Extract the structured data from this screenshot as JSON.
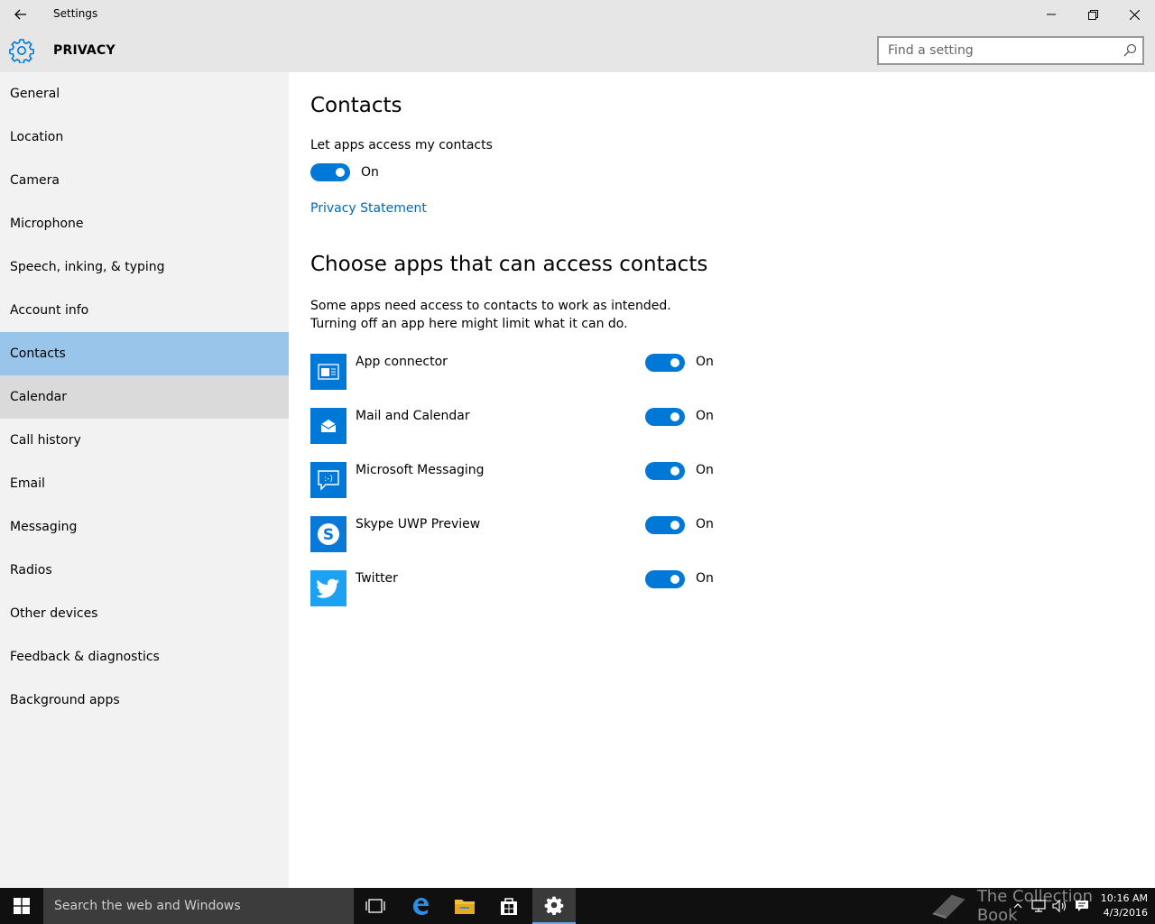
{
  "window": {
    "title": "Settings",
    "back_icon": "back-arrow-icon",
    "minimize_icon": "minimize-icon",
    "restore_icon": "restore-icon",
    "close_icon": "close-icon"
  },
  "header": {
    "icon": "gear-icon",
    "title": "PRIVACY",
    "search": {
      "placeholder": "Find a setting",
      "value": "",
      "icon": "search-icon"
    }
  },
  "sidebar": {
    "items": [
      {
        "label": "General",
        "state": ""
      },
      {
        "label": "Location",
        "state": ""
      },
      {
        "label": "Camera",
        "state": ""
      },
      {
        "label": "Microphone",
        "state": ""
      },
      {
        "label": "Speech, inking, & typing",
        "state": ""
      },
      {
        "label": "Account info",
        "state": ""
      },
      {
        "label": "Contacts",
        "state": "selected"
      },
      {
        "label": "Calendar",
        "state": "hover"
      },
      {
        "label": "Call history",
        "state": ""
      },
      {
        "label": "Email",
        "state": ""
      },
      {
        "label": "Messaging",
        "state": ""
      },
      {
        "label": "Radios",
        "state": ""
      },
      {
        "label": "Other devices",
        "state": ""
      },
      {
        "label": "Feedback & diagnostics",
        "state": ""
      },
      {
        "label": "Background apps",
        "state": ""
      }
    ]
  },
  "main": {
    "heading": "Contacts",
    "master_toggle": {
      "label": "Let apps access my contacts",
      "state": "On",
      "on": true
    },
    "privacy_link": "Privacy Statement",
    "apps_heading": "Choose apps that can access contacts",
    "apps_description": "Some apps need access to contacts to work as intended. Turning off an app here might limit what it can do.",
    "apps": [
      {
        "name": "App connector",
        "icon": "app-connector-icon",
        "state": "On",
        "on": true
      },
      {
        "name": "Mail and Calendar",
        "icon": "mail-icon",
        "state": "On",
        "on": true
      },
      {
        "name": "Microsoft Messaging",
        "icon": "messaging-icon",
        "state": "On",
        "on": true
      },
      {
        "name": "Skype UWP Preview",
        "icon": "skype-icon",
        "state": "On",
        "on": true
      },
      {
        "name": "Twitter",
        "icon": "twitter-icon",
        "state": "On",
        "on": true
      }
    ]
  },
  "taskbar": {
    "start_icon": "windows-logo-icon",
    "search_placeholder": "Search the web and Windows",
    "pinned": [
      "task-view-icon",
      "edge-icon",
      "file-explorer-icon",
      "store-icon",
      "settings-icon"
    ],
    "watermark": "The Collection Book",
    "tray": [
      "chevron-up-icon",
      "network-icon",
      "volume-icon",
      "action-center-icon"
    ],
    "time": "10:16 AM",
    "date": "4/3/2016"
  },
  "colors": {
    "accent": "#0078d7",
    "selected_nav": "#99c5ea",
    "hover_nav": "#dadada",
    "link": "#0067b8",
    "twitter": "#1da1f2"
  }
}
